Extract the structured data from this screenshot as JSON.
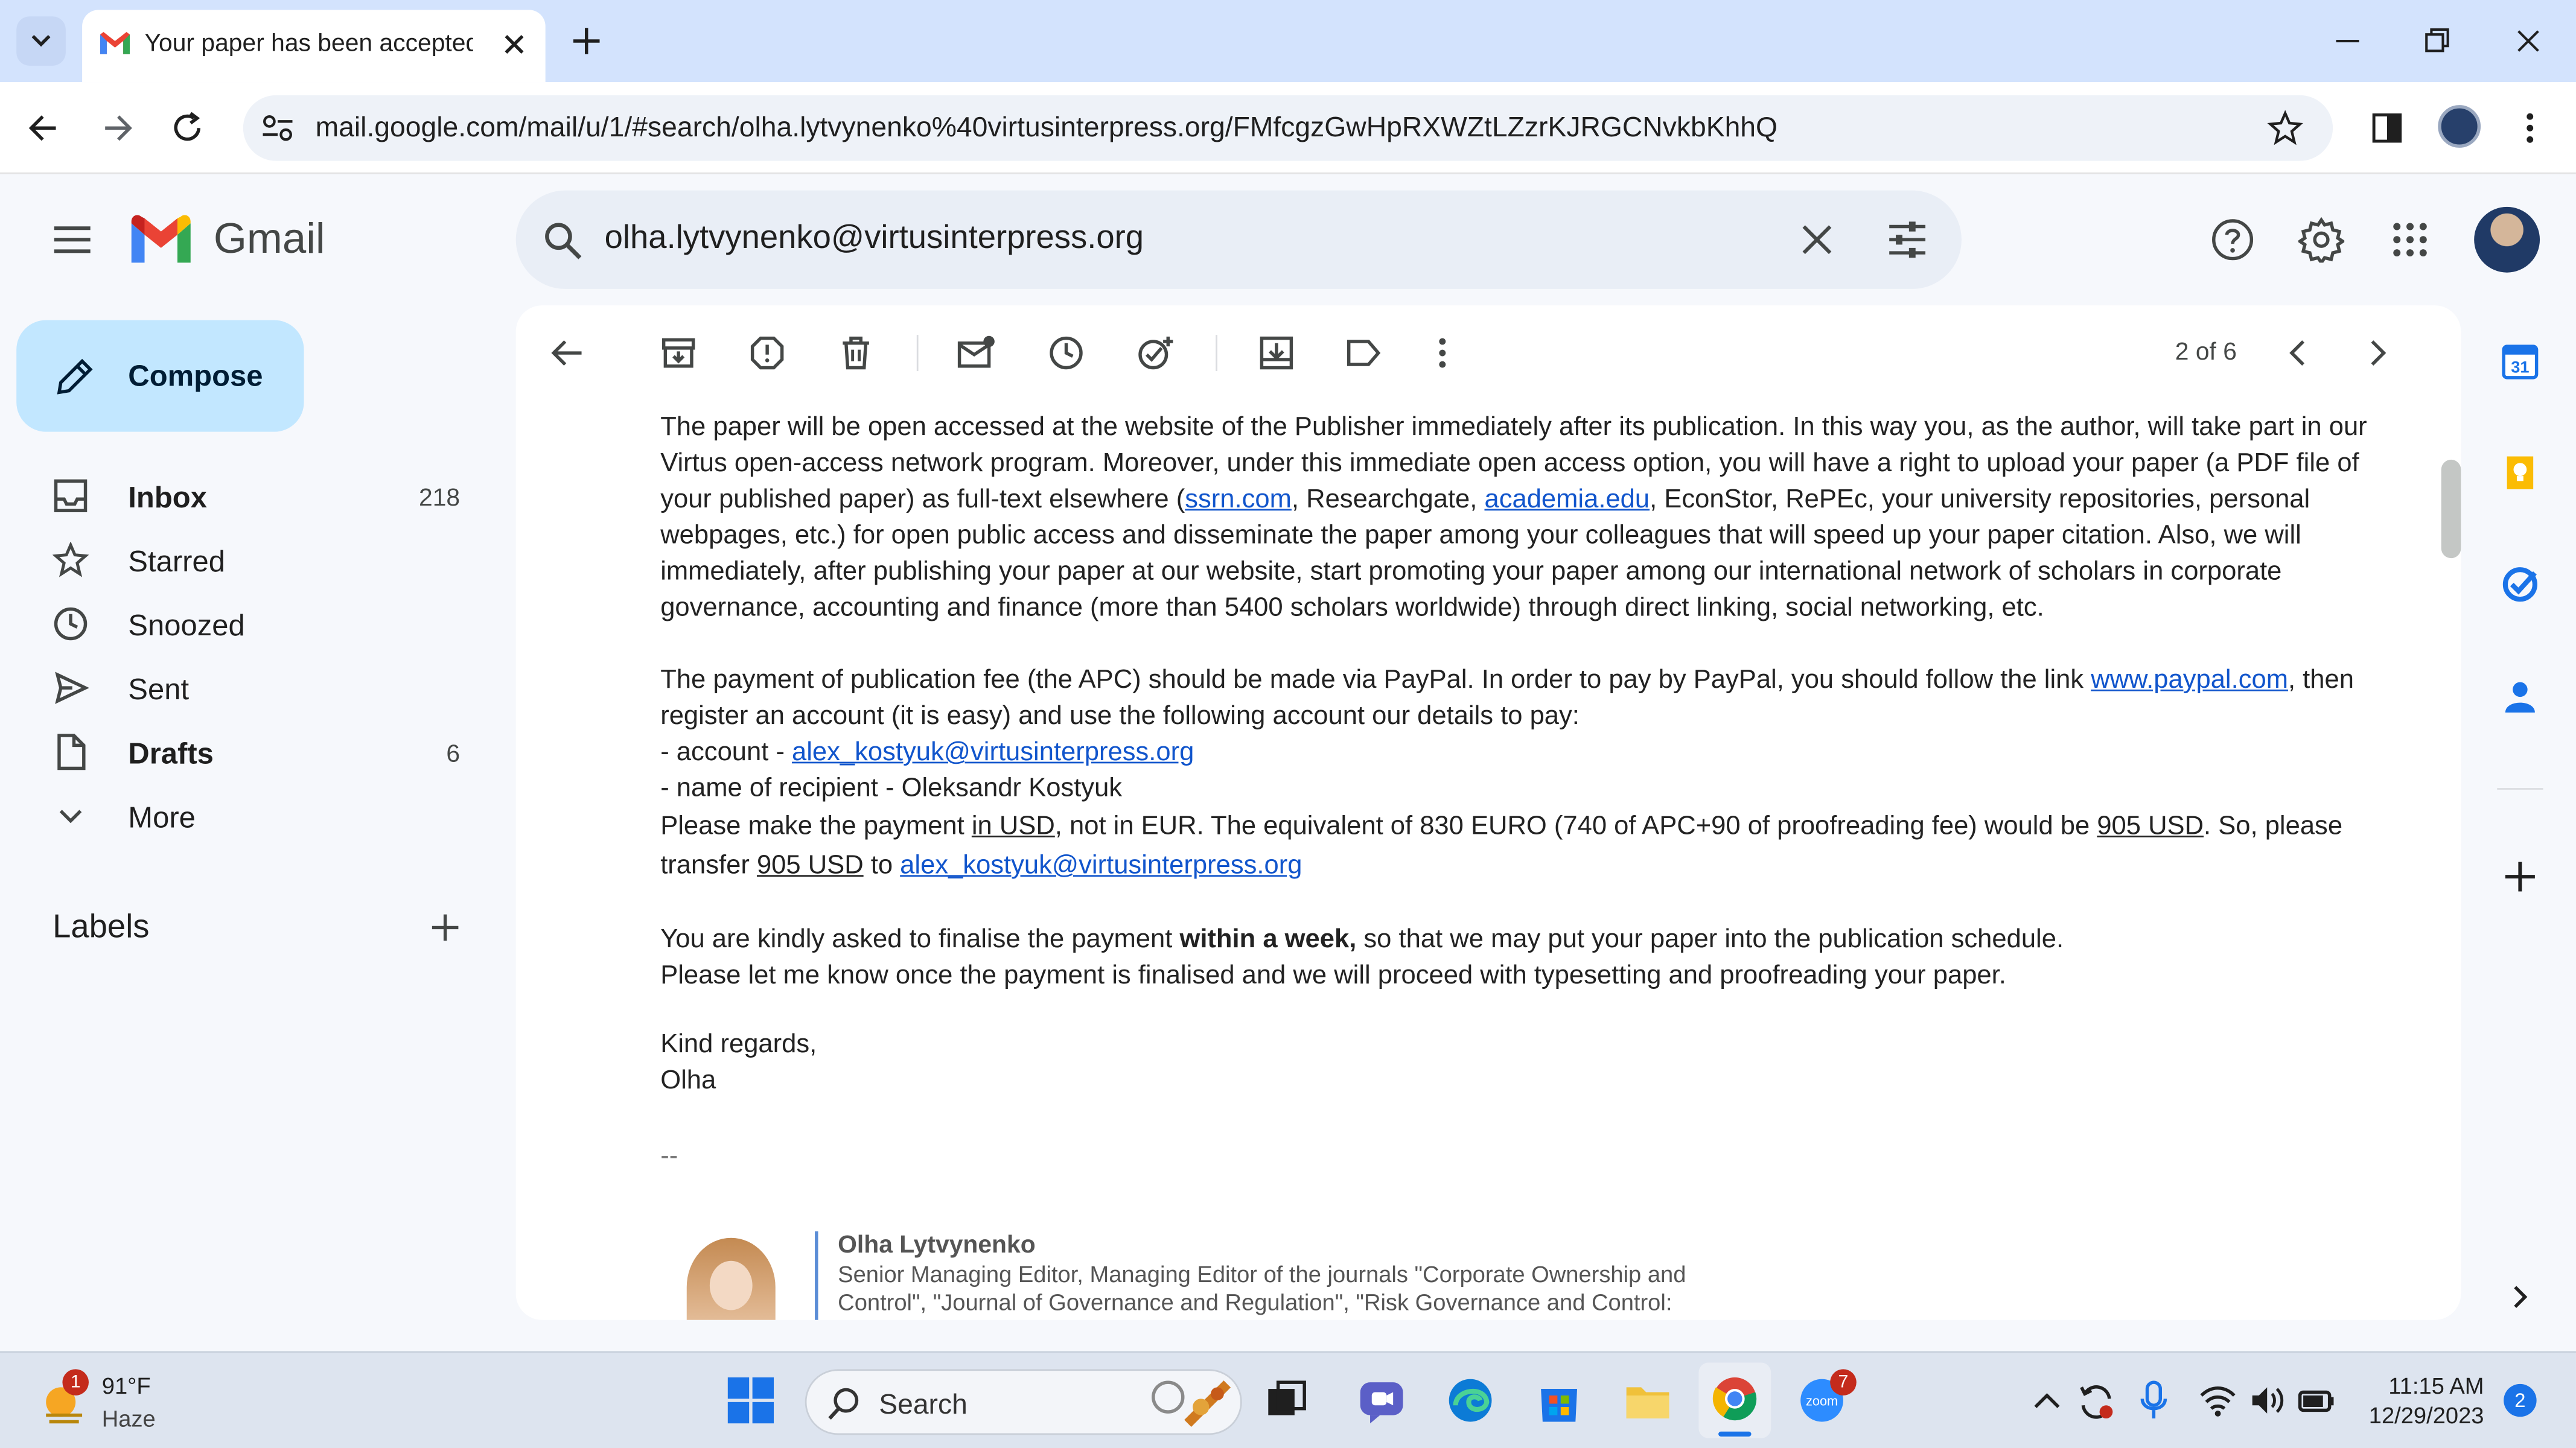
{
  "browser": {
    "tab_title": "Your paper has been accepted_",
    "url": "mail.google.com/mail/u/1/#search/olha.lytvynenko%40virtusinterpress.org/FMfcgzGwHpRXWZtLZzrKJRGCNvkbKhhQ"
  },
  "gmail": {
    "logo_text": "Gmail",
    "search_query": "olha.lytvynenko@virtusinterpress.org"
  },
  "sidebar": {
    "compose_label": "Compose",
    "items": [
      {
        "label": "Inbox",
        "count": "218"
      },
      {
        "label": "Starred",
        "count": ""
      },
      {
        "label": "Snoozed",
        "count": ""
      },
      {
        "label": "Sent",
        "count": ""
      },
      {
        "label": "Drafts",
        "count": "6"
      },
      {
        "label": "More",
        "count": ""
      }
    ],
    "labels_title": "Labels"
  },
  "toolbar": {
    "paging": "2 of 6"
  },
  "email": {
    "p1": {
      "a": "The paper will be open accessed at the website of the Publisher immediately after its publication. In this way you, as the author, will take part in our Virtus open-access network program. Moreover, under this immediate open access option, you will have a right to upload your paper (a PDF file of your published paper) as full-text elsewhere (",
      "link1": "ssrn.com",
      "b": ", Researchgate, ",
      "link2": "academia.edu",
      "c": ", EconStor, RePEc, your university repositories, personal webpages, etc.) for open public access and disseminate the paper among your colleagues that will speed up your paper citation. Also, we will immediately, after publishing your paper at our website, start promoting your paper among our international network of scholars in corporate governance, accounting and finance (more than 5400 scholars worldwide) through direct linking, social networking, etc."
    },
    "p2": {
      "a": "The payment of publication fee (the APC) should be made via PayPal. In order to pay by PayPal, you should follow the link ",
      "link1": "www.paypal.com",
      "b": ", then register an account (it is easy) and use the following account our details to pay:",
      "account_prefix": "- account - ",
      "account_link": "alex_kostyuk@virtusinterpress.org",
      "recipient": "- name of recipient - Oleksandr Kostyuk",
      "pay_a": "Please make the payment ",
      "pay_usd": "in USD",
      "pay_b": ", not in EUR. The equivalent of  830 EURO (740 of APC+90 of proofreading fee) would be ",
      "pay_amount": "905 USD",
      "pay_c": ". So, please transfer ",
      "pay_amount2": "905 USD",
      "pay_d": " to ",
      "pay_link": "alex_kostyuk@virtusinterpress.org"
    },
    "p3": {
      "a": "You are kindly asked to finalise the payment ",
      "bold": "within a week,",
      "b": " so that we may put your paper into the publication schedule.",
      "line2": "Please let me know once the payment is finalised and we will proceed with typesetting and proofreading your paper."
    },
    "closing": "Kind regards,",
    "sender_first": "Olha",
    "sig_sep": "--",
    "signature": {
      "name": "Olha Lytvynenko",
      "role": "Senior Managing Editor, Managing Editor of the journals \"Corporate Ownership and Control\", \"Journal of Governance and Regulation\", \"Risk Governance and Control:"
    }
  },
  "taskbar": {
    "weather_temp": "91°F",
    "weather_desc": "Haze",
    "weather_badge": "1",
    "search_label": "Search",
    "zoom_badge": "7",
    "time": "11:15 AM",
    "date": "12/29/2023",
    "notif_count": "2"
  }
}
